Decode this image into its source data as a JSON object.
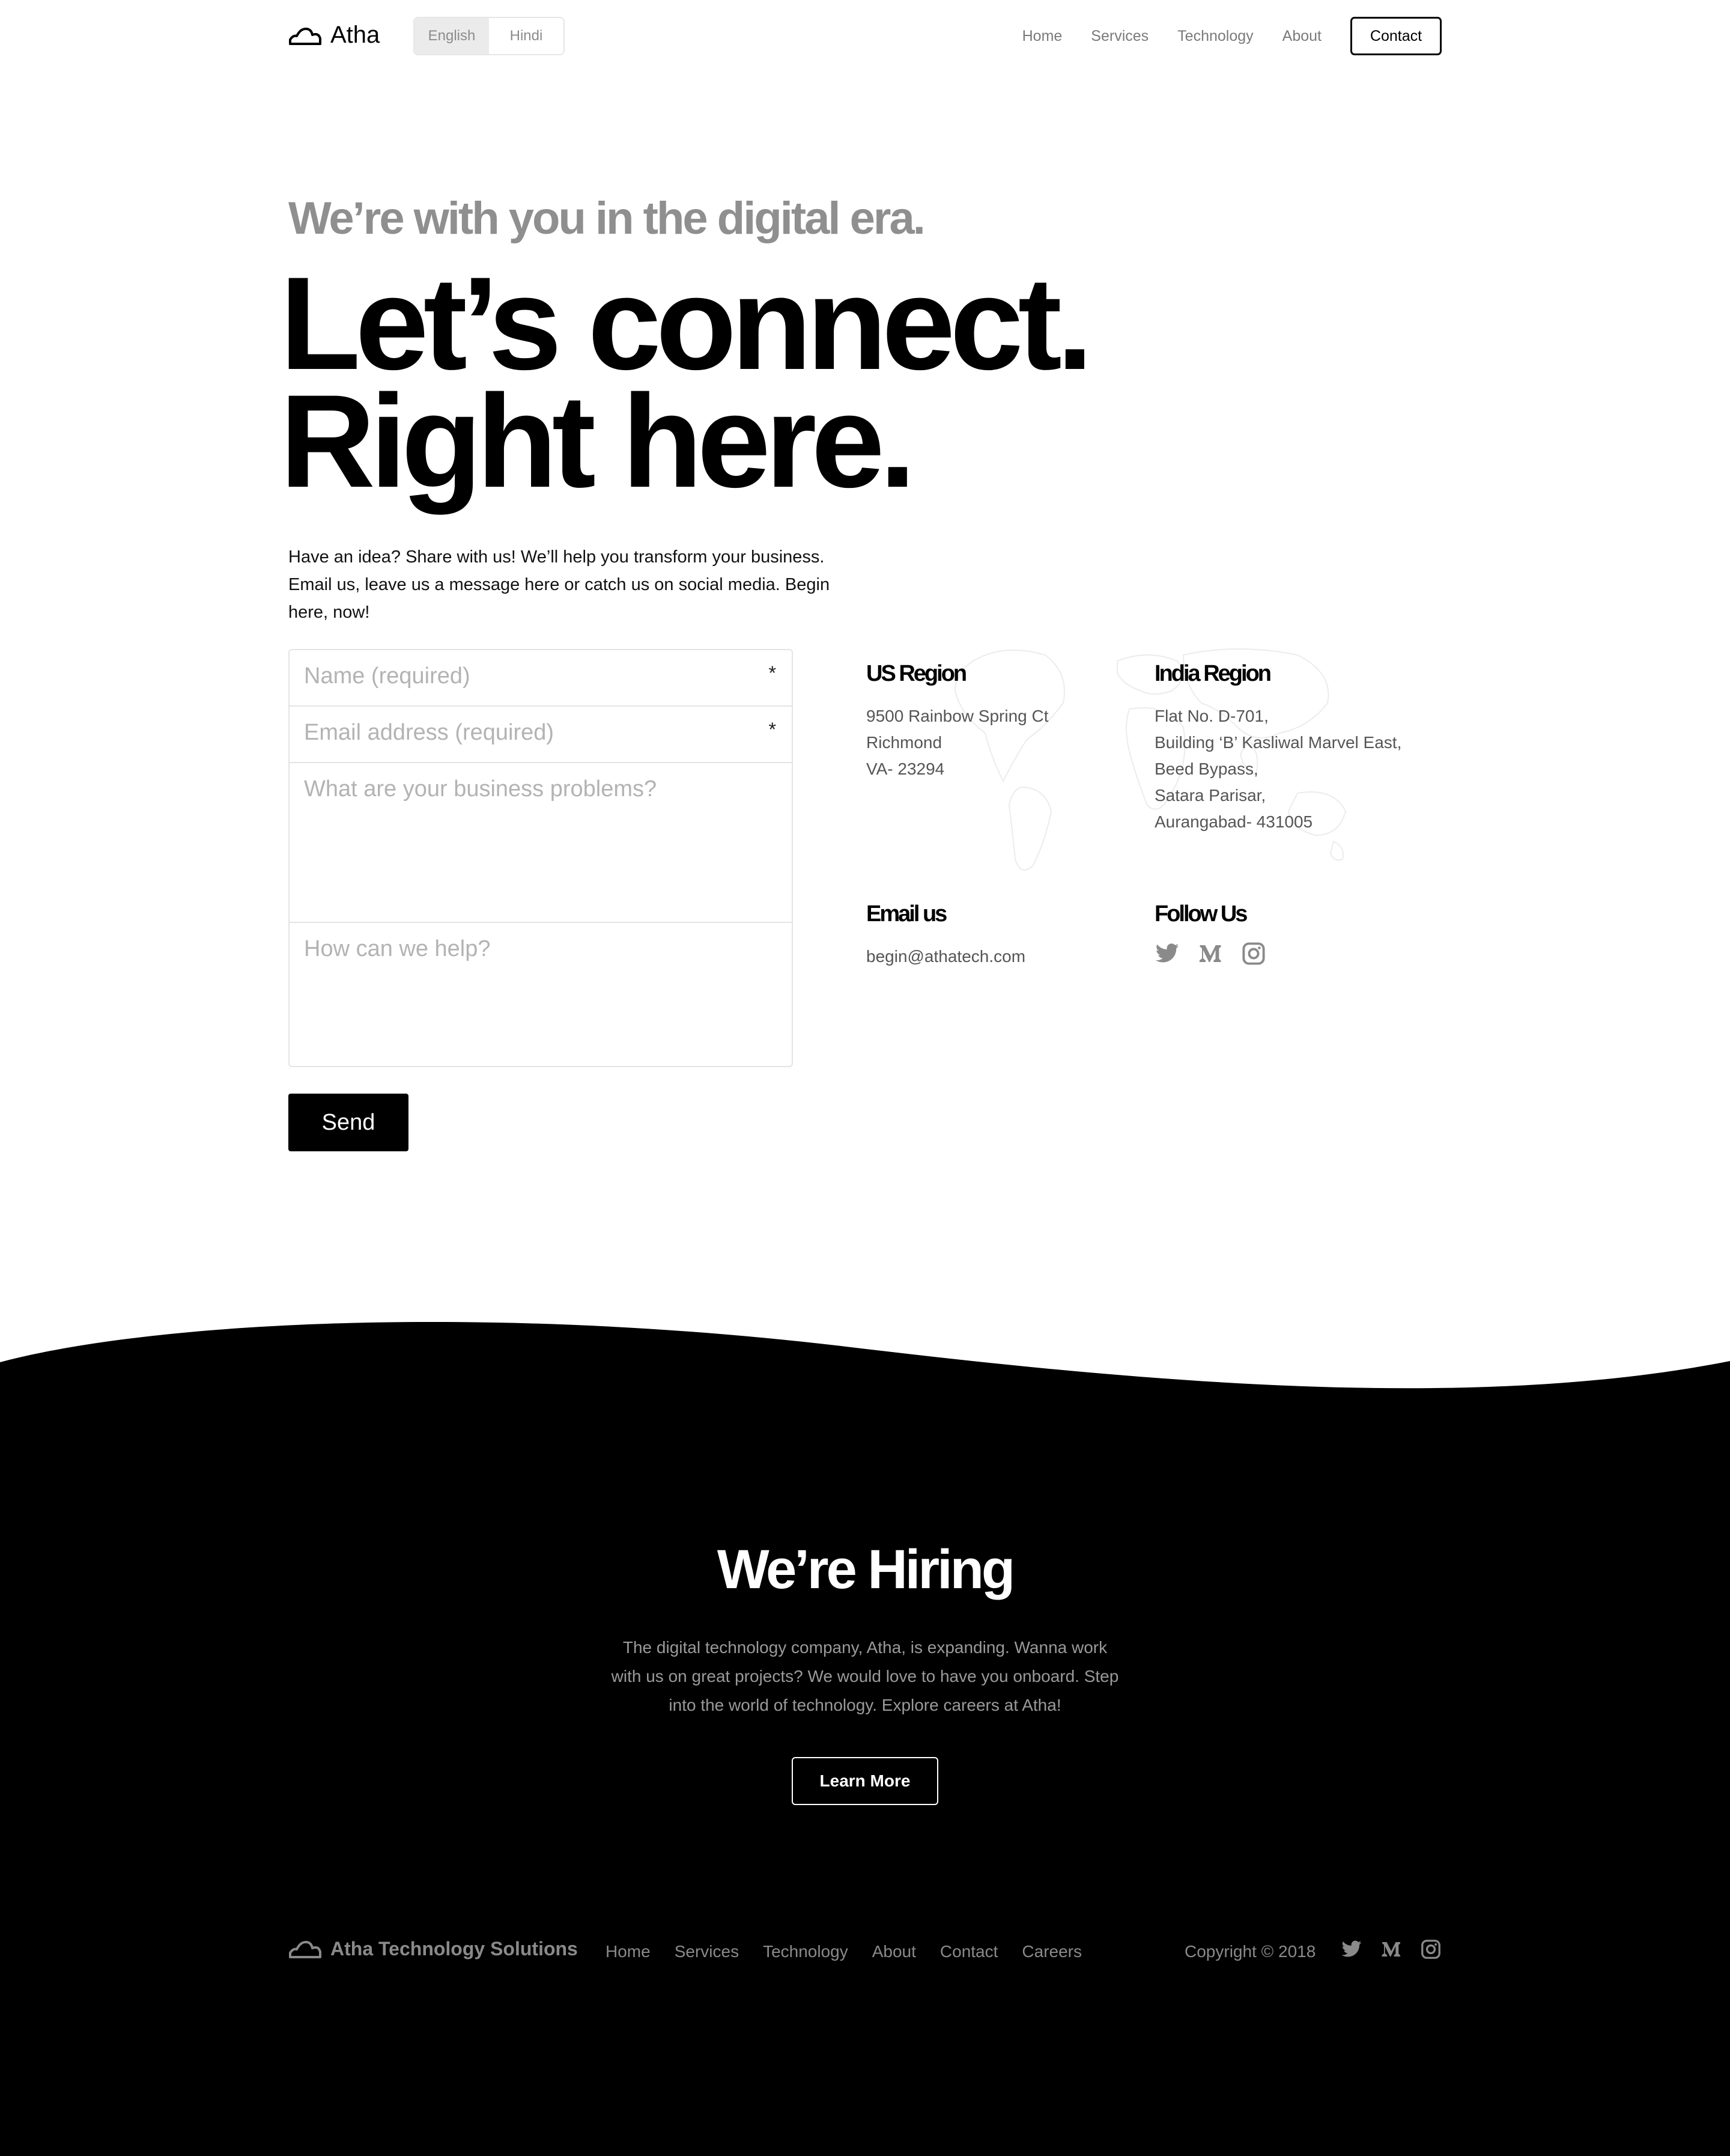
{
  "header": {
    "brand": "Atha",
    "languages": [
      {
        "label": "English",
        "active": true
      },
      {
        "label": "Hindi",
        "active": false
      }
    ],
    "nav": [
      "Home",
      "Services",
      "Technology",
      "About"
    ],
    "contact_label": "Contact"
  },
  "hero": {
    "eyebrow": "We’re with you in the digital era.",
    "headline_line1": "Let’s connect.",
    "headline_line2": "Right here.",
    "intro": "Have an idea? Share with us! We’ll help you transform your business. Email us, leave us a message here or catch us on social media. Begin here, now!"
  },
  "form": {
    "name_placeholder": "Name (required)",
    "email_placeholder": "Email address (required)",
    "problems_placeholder": "What are your business problems?",
    "help_placeholder": "How can we help?",
    "required_mark": "*",
    "send_label": "Send"
  },
  "contact_info": {
    "us_region": {
      "title": "US Region",
      "lines": [
        "9500 Rainbow Spring Ct",
        "Richmond",
        "VA- 23294"
      ]
    },
    "india_region": {
      "title": "India Region",
      "lines": [
        "Flat No. D-701,",
        "Building ‘B’ Kasliwal Marvel East,",
        "Beed Bypass,",
        "Satara Parisar,",
        "Aurangabad- 431005"
      ]
    },
    "email": {
      "title": "Email us",
      "address": "begin@athatech.com"
    },
    "follow": {
      "title": "Follow Us",
      "icons": [
        "twitter-icon",
        "medium-icon",
        "instagram-icon"
      ]
    }
  },
  "hiring": {
    "title": "We’re Hiring",
    "text": "The digital technology company, Atha, is expanding. Wanna work with us on great projects?  We would love to have you onboard. Step into the world of technology. Explore careers at Atha!",
    "button_label": "Learn More"
  },
  "footer": {
    "brand": "Atha Technology Solutions",
    "nav": [
      "Home",
      "Services",
      "Technology",
      "About",
      "Contact",
      "Careers"
    ],
    "copyright": "Copyright © 2018",
    "icons": [
      "twitter-icon",
      "medium-icon",
      "instagram-icon"
    ]
  },
  "colors": {
    "background": "#ffffff",
    "dark_section": "#000000",
    "muted_text": "#8f8f8f",
    "border": "#e4e4e4"
  }
}
